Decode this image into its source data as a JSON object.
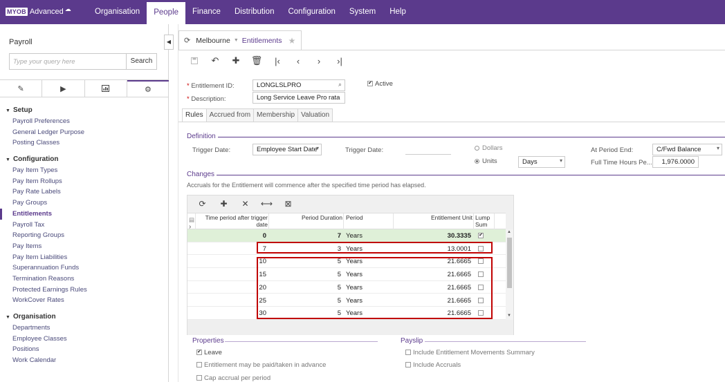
{
  "brand": {
    "logo": "MYOB",
    "product": "Advanced"
  },
  "nav": [
    "Organisation",
    "People",
    "Finance",
    "Distribution",
    "Configuration",
    "System",
    "Help"
  ],
  "left": {
    "title": "Payroll",
    "search_placeholder": "Type your query here",
    "search_button": "Search",
    "groups": [
      {
        "label": "Setup",
        "items": [
          "Payroll Preferences",
          "General Ledger Purpose",
          "Posting Classes"
        ]
      },
      {
        "label": "Configuration",
        "items": [
          "Pay Item Types",
          "Pay Item Rollups",
          "Pay Rate Labels",
          "Pay Groups",
          "Entitlements",
          "Payroll Tax",
          "Reporting Groups",
          "Pay Items",
          "Pay Item Liabilities",
          "Superannuation Funds",
          "Termination Reasons",
          "Protected Earnings Rules",
          "WorkCover Rates"
        ]
      },
      {
        "label": "Organisation",
        "items": [
          "Departments",
          "Employee Classes",
          "Positions",
          "Work Calendar"
        ]
      }
    ]
  },
  "breadcrumb": {
    "parent": "Melbourne",
    "current": "Entitlements"
  },
  "form": {
    "entitlement_id_label": "Entitlement ID:",
    "entitlement_id": "LONGLSLPRO",
    "description_label": "Description:",
    "description": "Long Service Leave Pro rata",
    "active_label": "Active"
  },
  "tabs": [
    "Rules",
    "Accrued from",
    "Membership",
    "Valuation"
  ],
  "definition": {
    "title": "Definition",
    "trigger_label": "Trigger Date:",
    "trigger_value": "Employee Start Date",
    "trigger2_label": "Trigger Date:",
    "dollars": "Dollars",
    "units": "Units",
    "unit_value": "Days",
    "period_end_label": "At Period End:",
    "period_end_value": "C/Fwd Balance",
    "fulltime_label": "Full Time Hours Pe...",
    "fulltime_value": "1,976.0000"
  },
  "changes": {
    "title": "Changes",
    "note": "Accruals for the Entitlement will commence after the specified time period has elapsed.",
    "headers": {
      "time": "Time period after trigger date",
      "duration": "Period Duration",
      "period": "Period",
      "unit": "Entitlement Unit",
      "lump": "Lump Sum"
    },
    "rows": [
      {
        "time": "0",
        "duration": "7",
        "period": "Years",
        "unit": "30.3335",
        "lump": "✔"
      },
      {
        "time": "7",
        "duration": "3",
        "period": "Years",
        "unit": "13.0001",
        "lump": ""
      },
      {
        "time": "10",
        "duration": "5",
        "period": "Years",
        "unit": "21.6665",
        "lump": ""
      },
      {
        "time": "15",
        "duration": "5",
        "period": "Years",
        "unit": "21.6665",
        "lump": ""
      },
      {
        "time": "20",
        "duration": "5",
        "period": "Years",
        "unit": "21.6665",
        "lump": ""
      },
      {
        "time": "25",
        "duration": "5",
        "period": "Years",
        "unit": "21.6665",
        "lump": ""
      },
      {
        "time": "30",
        "duration": "5",
        "period": "Years",
        "unit": "21.6665",
        "lump": ""
      }
    ]
  },
  "properties": {
    "title": "Properties",
    "items": [
      {
        "label": "Leave",
        "checked": true
      },
      {
        "label": "Entitlement may be paid/taken in advance",
        "checked": false
      },
      {
        "label": "Cap accrual per period",
        "checked": false
      }
    ]
  },
  "payslip": {
    "title": "Payslip",
    "items": [
      {
        "label": "Include Entitlement Movements Summary",
        "checked": false
      },
      {
        "label": "Include Accruals",
        "checked": false
      }
    ]
  }
}
